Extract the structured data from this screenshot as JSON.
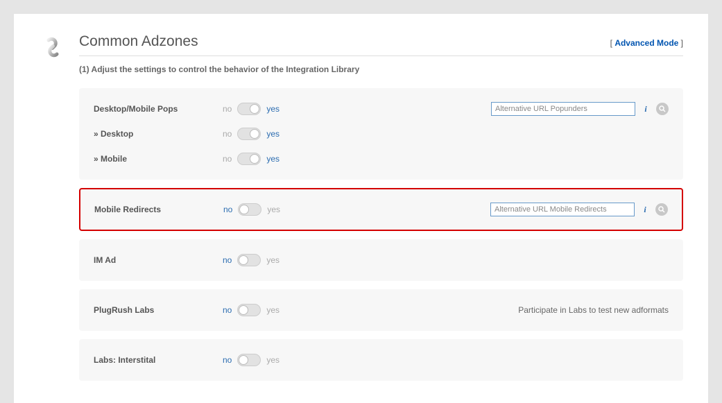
{
  "header": {
    "title": "Common Adzones",
    "advanced_mode": "Advanced Mode",
    "subtitle": "(1) Adjust the settings to control the behavior of the Integration Library"
  },
  "sections": {
    "pops": {
      "main_label": "Desktop/Mobile Pops",
      "desktop_label": "» Desktop",
      "mobile_label": "» Mobile",
      "url_placeholder": "Alternative URL Popunders"
    },
    "redirects": {
      "label": "Mobile Redirects",
      "url_placeholder": "Alternative URL Mobile Redirects"
    },
    "imad": {
      "label": "IM Ad"
    },
    "plugrush": {
      "label": "PlugRush Labs",
      "note": "Participate in Labs to test new adformats"
    },
    "interstitial": {
      "label": "Labs: Interstital"
    }
  },
  "toggle": {
    "no": "no",
    "yes": "yes"
  }
}
